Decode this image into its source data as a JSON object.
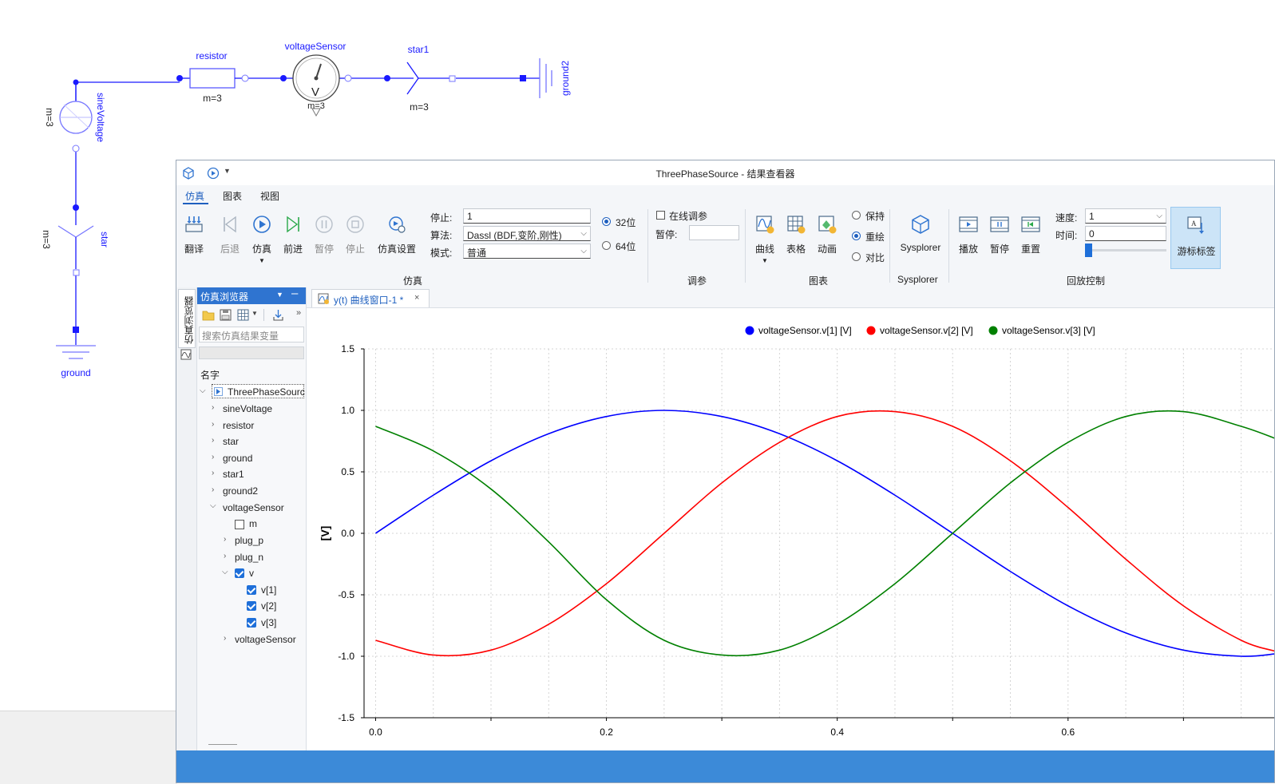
{
  "schematic": {
    "resistor": {
      "name": "resistor",
      "param": "m=3"
    },
    "voltageSensor": {
      "name": "voltageSensor",
      "param": "m=3",
      "symbol": "V"
    },
    "star1": {
      "name": "star1",
      "param": "m=3"
    },
    "ground2": {
      "name": "ground2"
    },
    "sineVoltage": {
      "name": "sineVoltage",
      "param": "m=3"
    },
    "star": {
      "name": "star",
      "param": "m=3"
    },
    "ground": {
      "name": "ground"
    },
    "wire_color": "#1a1aff"
  },
  "window": {
    "title": "ThreePhaseSource - 结果查看器",
    "menu": [
      "仿真",
      "图表",
      "视图"
    ],
    "active_menu": "仿真"
  },
  "ribbon": {
    "sim_buttons": [
      {
        "label": "翻译",
        "icon": "translate-icon",
        "enabled": true
      },
      {
        "label": "后退",
        "icon": "step-back-icon",
        "enabled": false
      },
      {
        "label": "仿真",
        "icon": "play-icon",
        "enabled": true
      },
      {
        "label": "前进",
        "icon": "step-forward-icon",
        "enabled": true
      },
      {
        "label": "暂停",
        "icon": "pause-icon",
        "enabled": false
      },
      {
        "label": "停止",
        "icon": "stop-icon",
        "enabled": false
      },
      {
        "label": "仿真设置",
        "icon": "sim-settings-icon",
        "enabled": true
      }
    ],
    "stop_label": "停止:",
    "stop_value": "1",
    "algo_label": "算法:",
    "algo_value": "Dassl (BDF,变阶,刚性)",
    "mode_label": "模式:",
    "mode_value": "普通",
    "bits_32": "32位",
    "bits_64": "64位",
    "sim_group": "仿真",
    "online_tune": "在线调参",
    "pause_label": "暂停:",
    "tune_group": "调参",
    "chart_buttons": [
      {
        "label": "曲线",
        "icon": "curve-icon"
      },
      {
        "label": "表格",
        "icon": "table-icon"
      },
      {
        "label": "动画",
        "icon": "animation-icon"
      }
    ],
    "keep": "保持",
    "redraw": "重绘",
    "compare": "对比",
    "chart_group": "图表",
    "sysplorer_label": "Sysplorer",
    "sysplorer_group": "Sysplorer",
    "playback_buttons": [
      {
        "label": "播放",
        "icon": "playback-play-icon"
      },
      {
        "label": "暂停",
        "icon": "playback-pause-icon"
      },
      {
        "label": "重置",
        "icon": "playback-reset-icon"
      }
    ],
    "speed_label": "速度:",
    "speed_value": "1",
    "time_label": "时间:",
    "time_value": "0",
    "cursor_label": "游标标签",
    "playback_group": "回放控制"
  },
  "browser": {
    "vertical_tab": "仿真浏览器",
    "title": "仿真浏览器",
    "search_placeholder": "搜索仿真结果变量",
    "column": "名字",
    "root": "ThreePhaseSourc",
    "items": [
      "sineVoltage",
      "resistor",
      "star",
      "ground",
      "star1",
      "ground2",
      "voltageSensor"
    ],
    "sensor_children": [
      "m",
      "plug_p",
      "plug_n",
      "v"
    ],
    "v_children": [
      "v[1]",
      "v[2]",
      "v[3]"
    ],
    "last_item": "voltageSensor"
  },
  "plot_tab": {
    "label": "y(t) 曲线窗口-1 *",
    "close": "×"
  },
  "chart_data": {
    "type": "line",
    "ylabel": "[V]",
    "xlim": [
      -0.01,
      0.78
    ],
    "ylim": [
      -1.5,
      1.5
    ],
    "x_ticks": [
      0.0,
      0.2,
      0.4,
      0.6
    ],
    "x_tick_labels": [
      "0.0",
      "0.2",
      "0.4",
      "0.6"
    ],
    "y_ticks": [
      1.5,
      1.0,
      0.5,
      0.0,
      -0.5,
      -1.0,
      -1.5
    ],
    "y_tick_labels": [
      "1.5",
      "1.0",
      "0.5",
      "0.0",
      "-0.5",
      "-1.0",
      "-1.5"
    ],
    "grid": true,
    "legend_position": "top",
    "x": [
      0.0,
      0.05,
      0.1,
      0.15,
      0.2,
      0.25,
      0.3,
      0.35,
      0.4,
      0.45,
      0.5,
      0.55,
      0.6,
      0.65,
      0.7,
      0.75,
      0.78
    ],
    "series": [
      {
        "name": "voltageSensor.v[1] [V]",
        "color": "#0000ff",
        "values": [
          0.0,
          0.31,
          0.59,
          0.81,
          0.95,
          1.0,
          0.95,
          0.81,
          0.59,
          0.31,
          0.0,
          -0.31,
          -0.59,
          -0.81,
          -0.95,
          -1.0,
          -0.98
        ]
      },
      {
        "name": "voltageSensor.v[2] [V]",
        "color": "#ff0000",
        "values": [
          -0.87,
          -0.99,
          -0.95,
          -0.74,
          -0.41,
          0.0,
          0.41,
          0.74,
          0.95,
          0.99,
          0.87,
          0.59,
          0.21,
          -0.21,
          -0.59,
          -0.87,
          -0.96
        ]
      },
      {
        "name": "voltageSensor.v[3] [V]",
        "color": "#008000",
        "values": [
          0.87,
          0.67,
          0.36,
          -0.07,
          -0.54,
          -0.87,
          -0.99,
          -0.95,
          -0.74,
          -0.41,
          0.0,
          0.41,
          0.74,
          0.95,
          0.99,
          0.87,
          0.77
        ]
      }
    ]
  }
}
